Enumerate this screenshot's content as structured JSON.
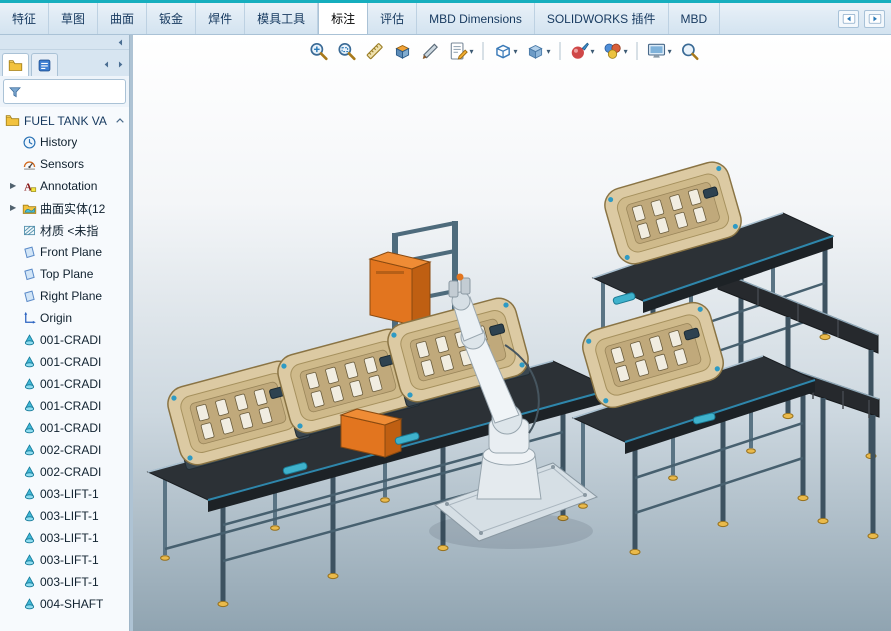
{
  "ribbon": {
    "tabs": [
      {
        "label": "特征",
        "active": false
      },
      {
        "label": "草图",
        "active": false
      },
      {
        "label": "曲面",
        "active": false
      },
      {
        "label": "钣金",
        "active": false
      },
      {
        "label": "焊件",
        "active": false
      },
      {
        "label": "模具工具",
        "active": false
      },
      {
        "label": "标注",
        "active": true
      },
      {
        "label": "评估",
        "active": false
      },
      {
        "label": "MBD Dimensions",
        "active": false
      },
      {
        "label": "SOLIDWORKS 插件",
        "active": false
      },
      {
        "label": "MBD",
        "active": false
      }
    ],
    "pane_buttons": [
      {
        "icon": "pane-left"
      },
      {
        "icon": "pane-right"
      }
    ]
  },
  "headsup_toolbar": {
    "items": [
      {
        "icon": "zoom-fit",
        "dropdown": false
      },
      {
        "icon": "zoom-area",
        "dropdown": false
      },
      {
        "icon": "measure",
        "dropdown": false
      },
      {
        "icon": "section-view",
        "dropdown": false
      },
      {
        "icon": "trim",
        "dropdown": false
      },
      {
        "icon": "annotation-note",
        "dropdown": true
      },
      {
        "type": "sep"
      },
      {
        "icon": "view-orientation",
        "dropdown": true
      },
      {
        "icon": "display-style",
        "dropdown": true
      },
      {
        "type": "sep"
      },
      {
        "icon": "edit-appearance",
        "dropdown": true
      },
      {
        "icon": "apply-scene",
        "dropdown": true
      },
      {
        "type": "sep"
      },
      {
        "icon": "view-settings",
        "dropdown": true
      },
      {
        "icon": "magnify",
        "dropdown": false
      }
    ]
  },
  "left_panel": {
    "tabs": [
      {
        "icon": "feature-tree"
      },
      {
        "icon": "property-list"
      }
    ],
    "filter": {
      "value": "",
      "icon": "filter-funnel"
    },
    "tree": {
      "root": {
        "label": "FUEL TANK VA",
        "icon": "folder"
      },
      "items": [
        {
          "label": "History",
          "icon": "history",
          "expandable": false
        },
        {
          "label": "Sensors",
          "icon": "sensors",
          "expandable": false
        },
        {
          "label": "Annotation",
          "icon": "annotations",
          "expandable": true
        },
        {
          "label": "曲面实体(12",
          "icon": "surface-folder",
          "expandable": true
        },
        {
          "label": "材质 <未指",
          "icon": "material",
          "expandable": false
        },
        {
          "label": "Front Plane",
          "icon": "plane",
          "expandable": false
        },
        {
          "label": "Top Plane",
          "icon": "plane",
          "expandable": false
        },
        {
          "label": "Right Plane",
          "icon": "plane",
          "expandable": false
        },
        {
          "label": "Origin",
          "icon": "origin",
          "expandable": false
        },
        {
          "label": "001-CRADI",
          "icon": "part",
          "expandable": false
        },
        {
          "label": "001-CRADI",
          "icon": "part",
          "expandable": false
        },
        {
          "label": "001-CRADI",
          "icon": "part",
          "expandable": false
        },
        {
          "label": "001-CRADI",
          "icon": "part",
          "expandable": false
        },
        {
          "label": "001-CRADI",
          "icon": "part",
          "expandable": false
        },
        {
          "label": "002-CRADI",
          "icon": "part",
          "expandable": false
        },
        {
          "label": "002-CRADI",
          "icon": "part",
          "expandable": false
        },
        {
          "label": "003-LIFT-1",
          "icon": "part",
          "expandable": false
        },
        {
          "label": "003-LIFT-1",
          "icon": "part",
          "expandable": false
        },
        {
          "label": "003-LIFT-1",
          "icon": "part",
          "expandable": false
        },
        {
          "label": "003-LIFT-1",
          "icon": "part",
          "expandable": false
        },
        {
          "label": "003-LIFT-1",
          "icon": "part",
          "expandable": false
        },
        {
          "label": "004-SHAFT",
          "icon": "part",
          "expandable": false
        }
      ]
    }
  },
  "colors": {
    "accent_teal": "#16aebe",
    "tabbar_bg": "#d3e3f0",
    "viewport_bottom": "#90a4b1",
    "model_tan": "#dccaa3",
    "model_orange": "#e2751f",
    "model_cyan": "#3fb2cc"
  }
}
